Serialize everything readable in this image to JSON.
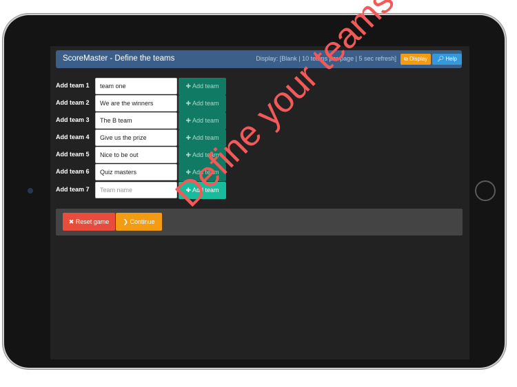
{
  "header": {
    "title": "ScoreMaster - Define the teams",
    "display_info": "Display: [Blank | 10 teams per page | 5 sec refresh]",
    "display_button": "Display",
    "help_button": "Help"
  },
  "teams": [
    {
      "label": "Add team 1",
      "value": "team one",
      "button": "Add team"
    },
    {
      "label": "Add team 2",
      "value": "We are the winners",
      "button": "Add team"
    },
    {
      "label": "Add team 3",
      "value": "The B team",
      "button": "Add team"
    },
    {
      "label": "Add team 4",
      "value": "Give us the prize",
      "button": "Add team"
    },
    {
      "label": "Add team 5",
      "value": "Nice to be out",
      "button": "Add team"
    },
    {
      "label": "Add team 6",
      "value": "Quiz masters",
      "button": "Add team"
    },
    {
      "label": "Add team 7",
      "value": "",
      "placeholder": "Team name",
      "button": "Add team"
    }
  ],
  "actions": {
    "reset": "Reset game",
    "continue": "Continue"
  },
  "overlay": "Define your teams",
  "colors": {
    "navbar": "#3c5f8a",
    "add_button": "#117a65",
    "add_button_active": "#18bc9c",
    "reset": "#e74c3c",
    "continue": "#f39c12",
    "help": "#3498db",
    "overlay": "#f25a5a"
  },
  "icons": {
    "display": "external-link-icon",
    "help": "search-icon",
    "add": "plus-icon",
    "reset": "close-icon",
    "continue": "chevron-right-icon"
  }
}
